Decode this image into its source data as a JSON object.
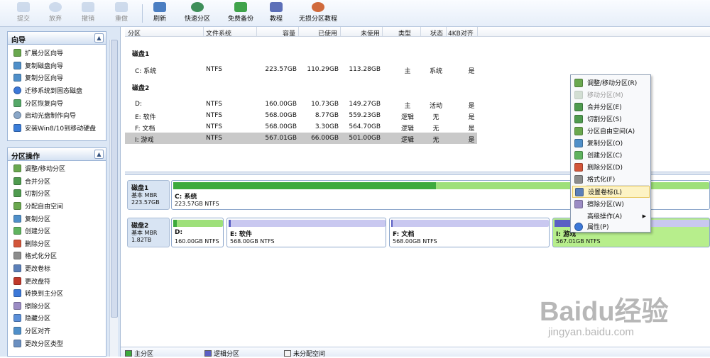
{
  "toolbar": {
    "submit": "提交",
    "discard": "放弃",
    "undo": "撤销",
    "redo": "重做",
    "refresh": "刷新",
    "quick_partition": "快速分区",
    "free_backup": "免费备份",
    "tutorial": "教程",
    "lossless_tutorial": "无损分区教程"
  },
  "wizard_panel": {
    "title": "向导",
    "items": [
      "扩展分区向导",
      "复制磁盘向导",
      "复制分区向导",
      "迁移系统到固态磁盘",
      "分区恢复向导",
      "启动光盘制作向导",
      "安装Win8/10到移动硬盘"
    ]
  },
  "ops_panel": {
    "title": "分区操作",
    "items": [
      "调整/移动分区",
      "合并分区",
      "切割分区",
      "分配自由空间",
      "复制分区",
      "创建分区",
      "删除分区",
      "格式化分区",
      "更改卷标",
      "更改盘符",
      "转换到主分区",
      "擦除分区",
      "隐藏分区",
      "分区对齐",
      "更改分区类型"
    ]
  },
  "table": {
    "headers": [
      "分区",
      "文件系统",
      "容量",
      "已使用",
      "未使用",
      "类型",
      "状态",
      "4KB对齐"
    ],
    "disk1_label": "磁盘1",
    "disk2_label": "磁盘2",
    "rows": [
      {
        "part": "C: 系统",
        "fs": "NTFS",
        "cap": "223.57GB",
        "used": "110.29GB",
        "free": "113.28GB",
        "type": "主",
        "status": "系统",
        "align": "是"
      },
      {
        "part": "D:",
        "fs": "NTFS",
        "cap": "160.00GB",
        "used": "10.73GB",
        "free": "149.27GB",
        "type": "主",
        "status": "活动",
        "align": "是"
      },
      {
        "part": "E: 软件",
        "fs": "NTFS",
        "cap": "568.00GB",
        "used": "8.77GB",
        "free": "559.23GB",
        "type": "逻辑",
        "status": "无",
        "align": "是"
      },
      {
        "part": "F: 文档",
        "fs": "NTFS",
        "cap": "568.00GB",
        "used": "3.30GB",
        "free": "564.70GB",
        "type": "逻辑",
        "status": "无",
        "align": "是"
      },
      {
        "part": "I: 游戏",
        "fs": "NTFS",
        "cap": "567.01GB",
        "used": "66.00GB",
        "free": "501.00GB",
        "type": "逻辑",
        "status": "无",
        "align": "是"
      }
    ]
  },
  "diskmap": {
    "disk1": {
      "name": "磁盘1",
      "type": "基本 MBR",
      "size": "223.57GB"
    },
    "disk2": {
      "name": "磁盘2",
      "type": "基本 MBR",
      "size": "1.82TB"
    },
    "parts": [
      {
        "name": "C: 系统",
        "desc": "223.57GB NTFS",
        "used_fraction": 0.49
      },
      {
        "name": "D:",
        "desc": "160.00GB NTFS",
        "used_fraction": 0.07
      },
      {
        "name": "E: 软件",
        "desc": "568.00GB NTFS",
        "used_fraction": 0.015
      },
      {
        "name": "F: 文档",
        "desc": "568.00GB NTFS",
        "used_fraction": 0.006
      },
      {
        "name": "I: 游戏",
        "desc": "567.01GB NTFS",
        "used_fraction": 0.12
      }
    ]
  },
  "context_menu": {
    "items": [
      {
        "label": "调整/移动分区(R)",
        "enabled": true
      },
      {
        "label": "移动分区(M)",
        "enabled": false
      },
      {
        "label": "合并分区(E)",
        "enabled": true
      },
      {
        "label": "切割分区(S)",
        "enabled": true
      },
      {
        "label": "分区自由空间(A)",
        "enabled": true
      },
      {
        "label": "复制分区(O)",
        "enabled": true
      },
      {
        "label": "创建分区(C)",
        "enabled": true
      },
      {
        "label": "删除分区(D)",
        "enabled": true
      },
      {
        "label": "格式化(F)",
        "enabled": true
      },
      {
        "label": "设置卷标(L)",
        "enabled": true,
        "highlighted": true
      },
      {
        "label": "擦除分区(W)",
        "enabled": true
      },
      {
        "label": "高级操作(A)",
        "enabled": true,
        "submenu": true
      },
      {
        "label": "属性(P)",
        "enabled": true
      }
    ]
  },
  "legend": {
    "primary": "主分区",
    "logical": "逻辑分区",
    "unallocated": "未分配空间"
  },
  "watermark": {
    "text": "Baidu经验",
    "url": "jingyan.baidu.com"
  },
  "colors": {
    "primary_bar": "#3daa3d",
    "primary_bg": "#9ee07a",
    "logical_bar": "#5b5fc4",
    "logical_bg": "#c9c8f0",
    "highlight": "#fdf3c4"
  }
}
